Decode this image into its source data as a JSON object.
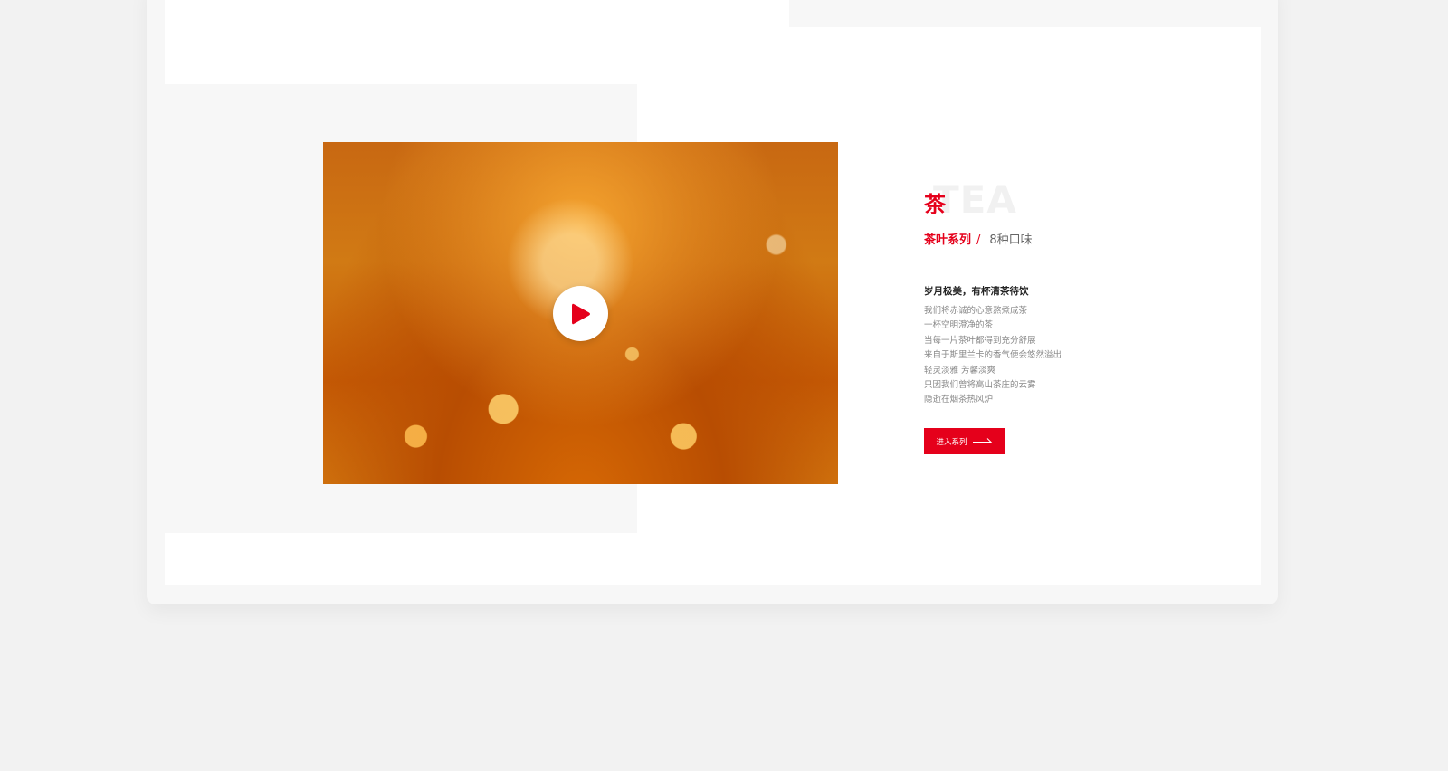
{
  "brand_color": "#e5001b",
  "section": {
    "bg_word": "TEA",
    "title": "茶",
    "series_name": "茶叶系列",
    "separator": "/",
    "flavor_count": "8种口味",
    "tagline": "岁月极美，有杯清茶待饮",
    "description_lines": [
      "我们将赤诚的心意熬煮成茶",
      "一杯空明澄净的茶",
      "当每一片茶叶都得到充分舒展",
      "来自于斯里兰卡的香气便会悠然溢出",
      "轻灵淡雅 芳馨淡爽",
      "只因我们曾将高山茶庄的云雾",
      "隐逝在烟茶热风炉"
    ],
    "enter_button_label": "进入系列"
  },
  "media": {
    "play_icon": "play-icon"
  }
}
